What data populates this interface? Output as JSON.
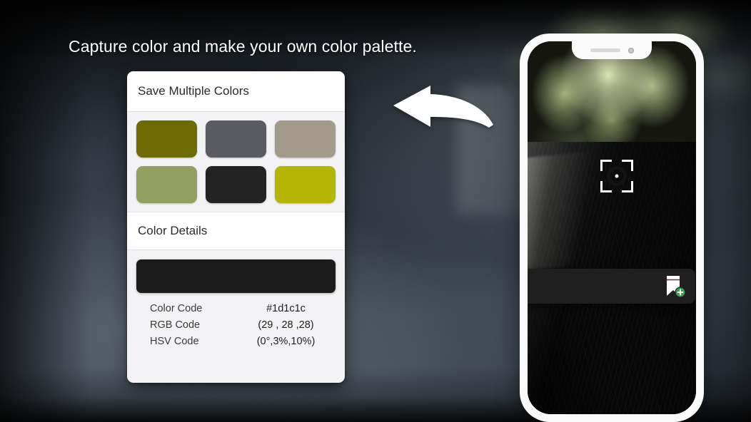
{
  "headline": "Capture color and make your own color palette.",
  "card": {
    "header_title": "Save Multiple Colors",
    "section_title": "Color Details",
    "swatches": [
      {
        "name": "swatch-olive",
        "hex": "#6d6b03"
      },
      {
        "name": "swatch-slate-gray",
        "hex": "#5a5a62"
      },
      {
        "name": "swatch-taupe",
        "hex": "#a39a8c"
      },
      {
        "name": "swatch-sage-green",
        "hex": "#91a05f"
      },
      {
        "name": "swatch-near-black",
        "hex": "#232323"
      },
      {
        "name": "swatch-yellow-green",
        "hex": "#b5b505"
      }
    ],
    "preview_hex": "#1d1c1c",
    "details": [
      {
        "label": "Color Code",
        "value": "#1d1c1c"
      },
      {
        "label": "RGB Code",
        "value": "(29 , 28 ,28)"
      },
      {
        "label": "HSV Code",
        "value": "(0°,3%,10%)"
      }
    ]
  },
  "arrow": {
    "icon": "curved-arrow-left-icon",
    "color": "#ffffff"
  },
  "phone": {
    "frame_color": "#fafafa",
    "notch": {
      "speaker_icon": "speaker-slot-icon",
      "camera_icon": "front-camera-icon"
    },
    "reticle_icon": "color-picker-reticle-icon",
    "toolbar": {
      "background": "#1f1f1f",
      "save_icon": "bookmark-add-icon",
      "badge_color": "#3a9e4f",
      "badge_icon": "plus-icon"
    }
  }
}
